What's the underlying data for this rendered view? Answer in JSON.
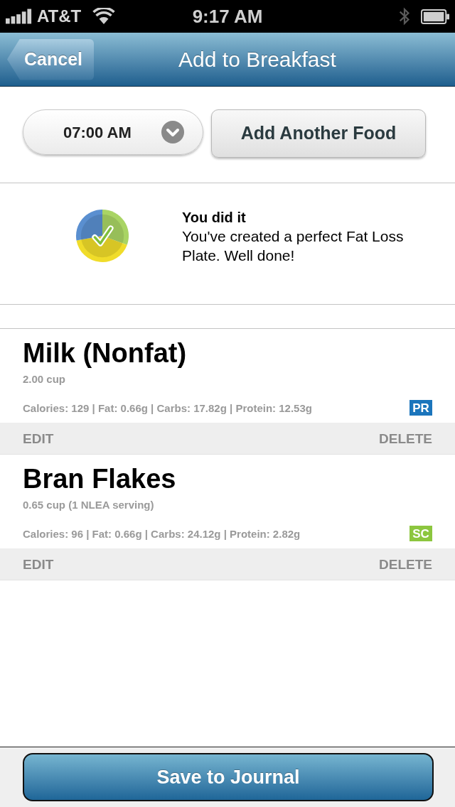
{
  "status_bar": {
    "carrier": "AT&T",
    "time": "9:17 AM"
  },
  "nav_bar": {
    "back_button": "Cancel",
    "title": "Add to Breakfast"
  },
  "time_picker": {
    "value": "07:00 AM"
  },
  "add_button": "Add Another Food",
  "message": {
    "title": "You did it",
    "body": "You've created a perfect Fat Loss Plate. Well done!"
  },
  "foods": [
    {
      "name": "Milk (Nonfat)",
      "serving": "2.00 cup",
      "nutrition": "Calories: 129 | Fat: 0.66g | Carbs: 17.82g | Protein: 12.53g",
      "tag": {
        "label": "PR",
        "color": "#1b75bc"
      },
      "edit": "EDIT",
      "delete": "DELETE"
    },
    {
      "name": "Bran Flakes",
      "serving": "0.65 cup (1 NLEA serving)",
      "nutrition": "Calories: 96 | Fat: 0.66g | Carbs: 24.12g | Protein: 2.82g",
      "tag": {
        "label": "SC",
        "color": "#8cc63f"
      },
      "edit": "EDIT",
      "delete": "DELETE"
    }
  ],
  "save_button": "Save to Journal"
}
